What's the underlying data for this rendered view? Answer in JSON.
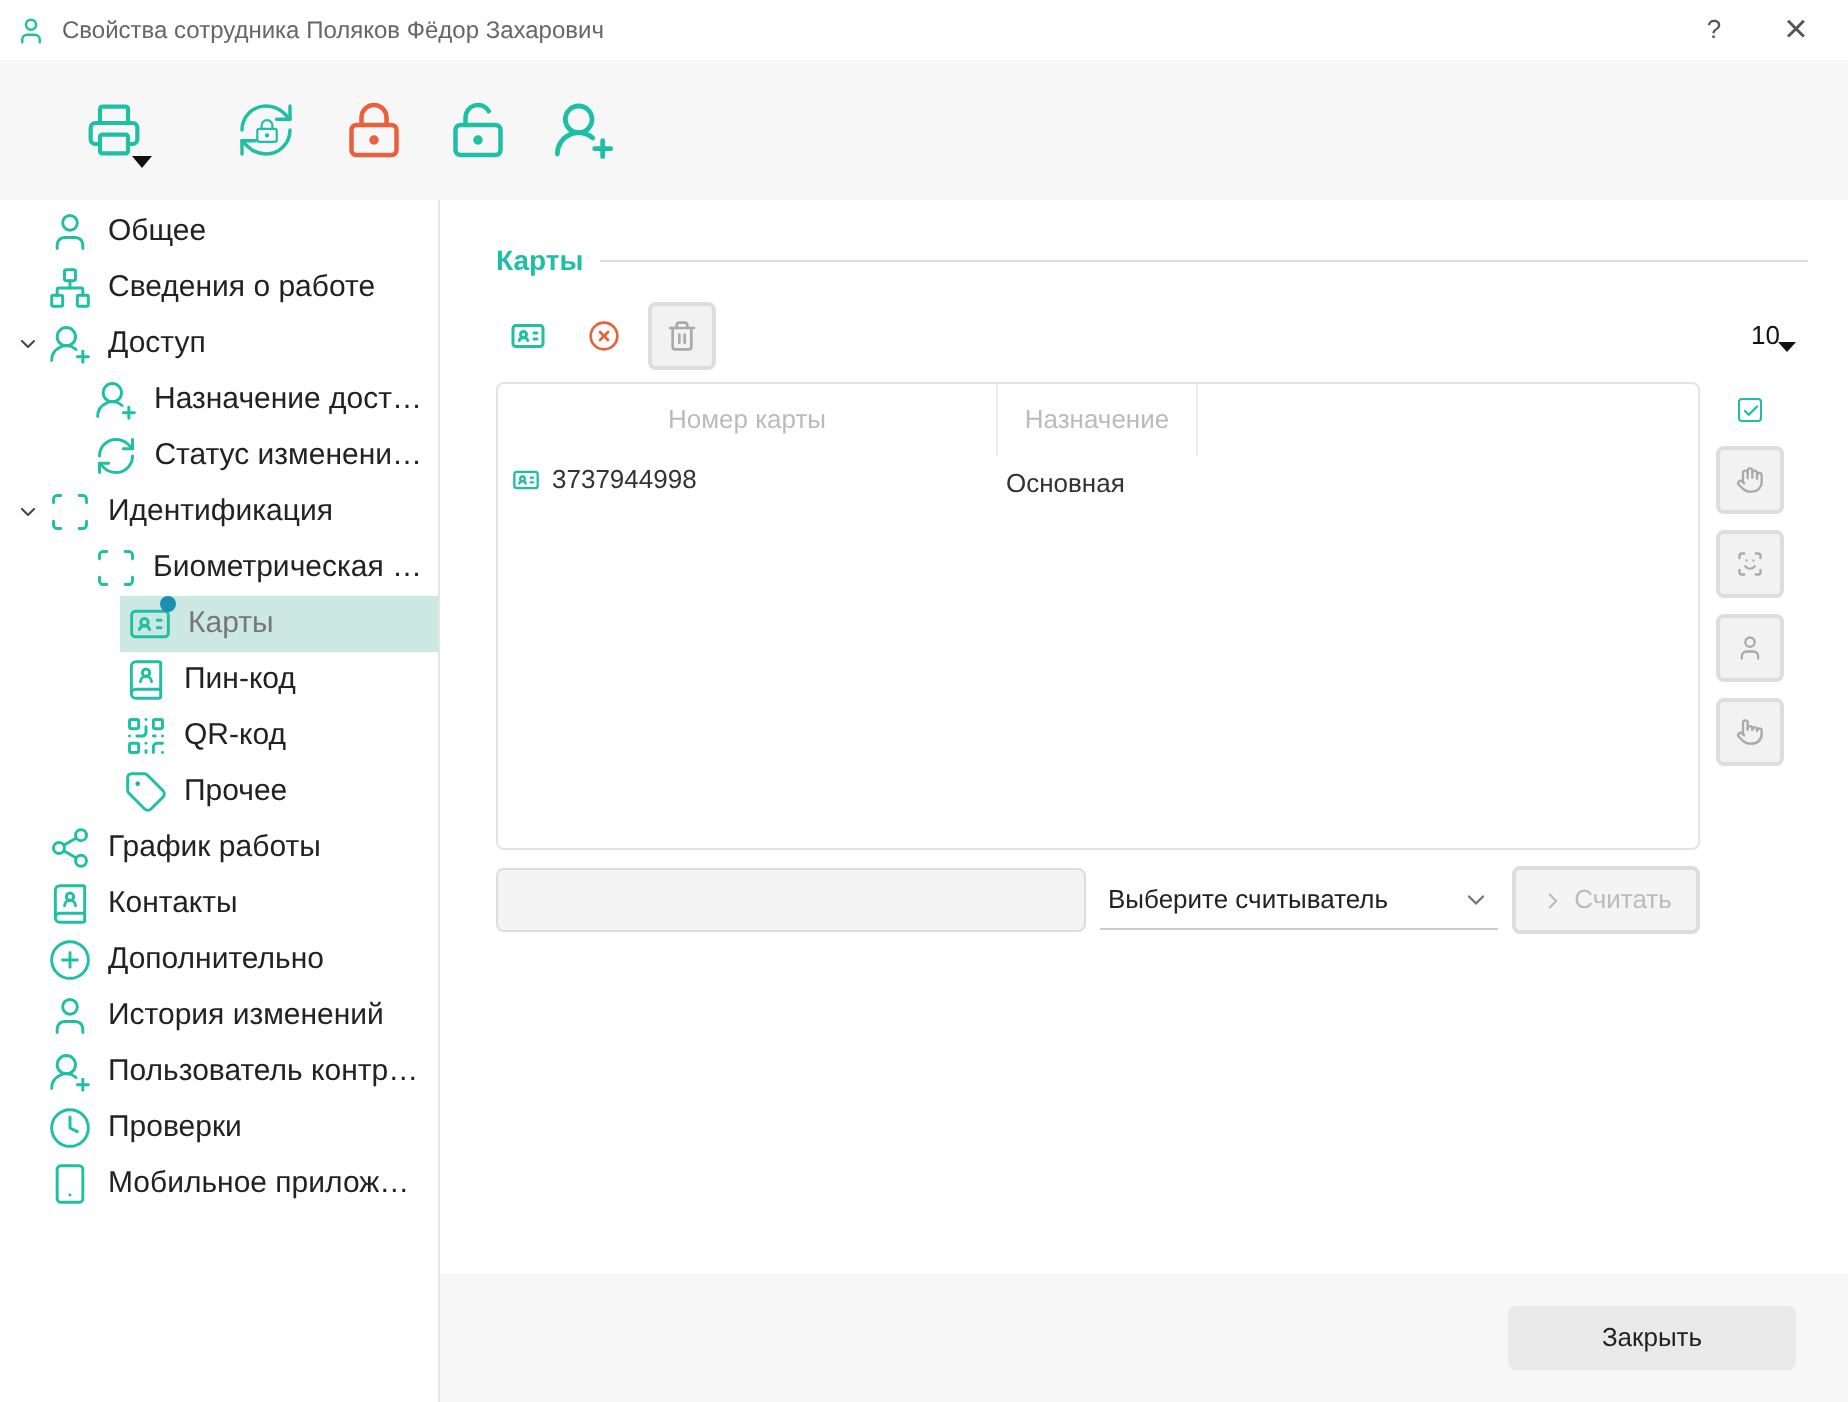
{
  "window": {
    "title": "Свойства сотрудника Поляков Фёдор Захарович",
    "help": "?",
    "close": "×"
  },
  "sidebar": {
    "items": [
      {
        "label": "Общее",
        "selected": false
      },
      {
        "label": "Сведения о работе",
        "selected": false
      },
      {
        "label": "Доступ",
        "selected": false,
        "expanded": true,
        "children": [
          {
            "label": "Назначение дост…",
            "selected": false
          },
          {
            "label": "Статус изменени…",
            "selected": false
          }
        ]
      },
      {
        "label": "Идентификация",
        "selected": false,
        "expanded": true,
        "children": [
          {
            "label": "Биометрическая …",
            "selected": false
          },
          {
            "label": "Карты",
            "selected": true
          },
          {
            "label": "Пин-код",
            "selected": false
          },
          {
            "label": "QR-код",
            "selected": false
          },
          {
            "label": "Прочее",
            "selected": false
          }
        ]
      },
      {
        "label": "График работы",
        "selected": false
      },
      {
        "label": "Контакты",
        "selected": false
      },
      {
        "label": "Дополнительно",
        "selected": false
      },
      {
        "label": "История изменений",
        "selected": false
      },
      {
        "label": "Пользователь контр…",
        "selected": false
      },
      {
        "label": "Проверки",
        "selected": false
      },
      {
        "label": "Мобильное прилож…",
        "selected": false
      }
    ]
  },
  "cards": {
    "title": "Карты",
    "page_size": "10",
    "table": {
      "columns": [
        "Номер карты",
        "Назначение"
      ],
      "rows": [
        {
          "number": "3737944998",
          "purpose": "Основная"
        }
      ]
    },
    "show_checkbox": {
      "checked": true
    },
    "reader_select": {
      "value": "Выберите считыватель"
    },
    "read_button": {
      "label": "Считать",
      "disabled": true
    }
  },
  "footer": {
    "close_button": "Закрыть"
  }
}
